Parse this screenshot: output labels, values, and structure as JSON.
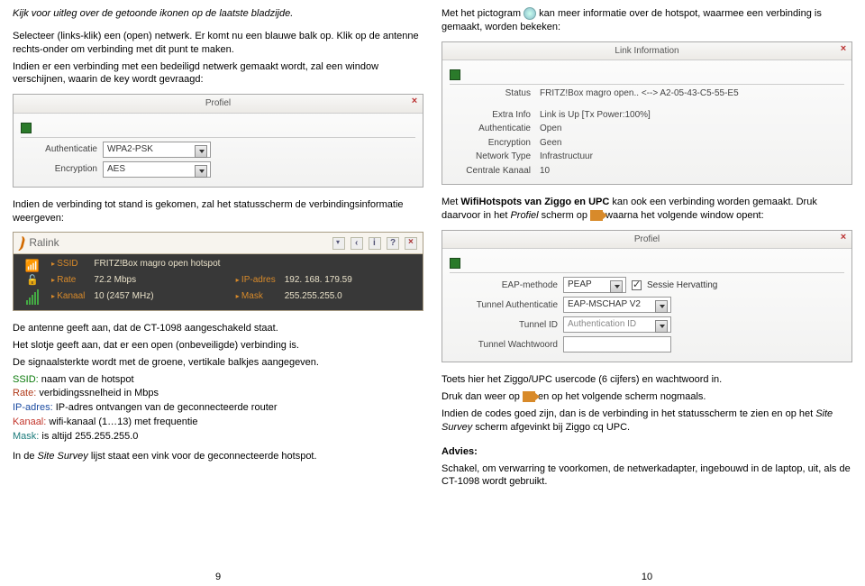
{
  "left": {
    "para1_italic": "Kijk voor uitleg over de getoonde ikonen op de laatste bladzijde.",
    "para2": "Selecteer (links-klik) een (open) netwerk. Er komt nu een blauwe balk op. Klik op de antenne rechts-onder om verbinding met dit punt te maken.",
    "para3": "Indien er een verbinding met een bedeiligd netwerk gemaakt wordt, zal een window verschijnen, waarin de key wordt gevraagd:",
    "profiel": {
      "title": "Profiel",
      "auth_label": "Authenticatie",
      "auth_value": "WPA2-PSK",
      "enc_label": "Encryption",
      "enc_value": "AES"
    },
    "para4": "Indien de verbinding tot stand is gekomen, zal het statusscherm de verbindingsinformatie weergeven:",
    "ralink": {
      "brand": "Ralink",
      "ssid_k": "SSID",
      "ssid_v": "FRITZ!Box magro open hotspot",
      "rate_k": "Rate",
      "rate_v": "72.2 Mbps",
      "ip_k": "IP-adres",
      "ip_v": "192. 168. 179.59",
      "kanaal_k": "Kanaal",
      "kanaal_v": "10 (2457 MHz)",
      "mask_k": "Mask",
      "mask_v": "255.255.255.0"
    },
    "para5a": "De antenne geeft aan, dat de CT-1098 aangeschakeld staat.",
    "para5b": "Het slotje geeft aan, dat er een open (onbeveiligde) verbinding is.",
    "para5c": "De signaalsterkte wordt met de groene, vertikale balkjes aangegeven.",
    "def_ssid_k": "SSID:",
    "def_ssid_v": " naam van de hotspot",
    "def_rate_k": "Rate:",
    "def_rate_v": " verbidingssnelheid in Mbps",
    "def_ip_k": "IP-adres:",
    "def_ip_v": " IP-adres ontvangen van de geconnecteerde router",
    "def_kan_k": "Kanaal:",
    "def_kan_v": " wifi-kanaal (1…13) met frequentie",
    "def_mask_k": "Mask:",
    "def_mask_v": " is altijd 255.255.255.0",
    "para6_a": "In de ",
    "para6_i": "Site Survey",
    "para6_b": " lijst staat een vink voor de geconnecteerde hotspot.",
    "pagenum": "9"
  },
  "right": {
    "para1a": "Met het pictogram ",
    "para1b": " kan meer informatie over de hotspot, waarmee een verbinding is gemaakt, worden bekeken:",
    "linkinfo": {
      "title": "Link Information",
      "rows": [
        {
          "k": "Status",
          "v": "FRITZ!Box magro open.. <--> A2-05-43-C5-55-E5"
        },
        {
          "k": "Extra Info",
          "v": "Link is Up  [Tx Power:100%]"
        },
        {
          "k": "Authenticatie",
          "v": "Open"
        },
        {
          "k": "Encryption",
          "v": "Geen"
        },
        {
          "k": "Network Type",
          "v": "Infrastructuur"
        },
        {
          "k": "Centrale Kanaal",
          "v": "10"
        }
      ]
    },
    "para2a": "Met ",
    "para2b": "WifiHotspots van Ziggo en UPC",
    "para2c": " kan ook een verbinding worden gemaakt. Druk daarvoor in het ",
    "para2d": "Profiel",
    "para2e": " scherm op ",
    "para2f": " waarna het volgende window opent:",
    "eapwin": {
      "title": "Profiel",
      "eap_k": "EAP-methode",
      "eap_v": "PEAP",
      "sessie": "Sessie Hervatting",
      "tauth_k": "Tunnel Authenticatie",
      "tauth_v": "EAP-MSCHAP V2",
      "tid_k": "Tunnel ID",
      "tid_ph": "Authentication ID",
      "tpw_k": "Tunnel Wachtwoord"
    },
    "para3a": "Toets hier het Ziggo/UPC usercode (6 cijfers) en wachtwoord in.",
    "para3b1": "Druk dan weer op ",
    "para3b2": " en op het volgende scherm nogmaals.",
    "para3c1": "Indien de codes goed zijn, dan is de verbinding in het statusscherm te zien en op het ",
    "para3c2": "Site Survey",
    "para3c3": " scherm afgevinkt bij Ziggo cq UPC.",
    "advies_h": "Advies:",
    "advies_b": "Schakel, om verwarring te voorkomen, de netwerkadapter, ingebouwd in de laptop, uit, als de CT-1098 wordt gebruikt.",
    "pagenum": "10"
  }
}
